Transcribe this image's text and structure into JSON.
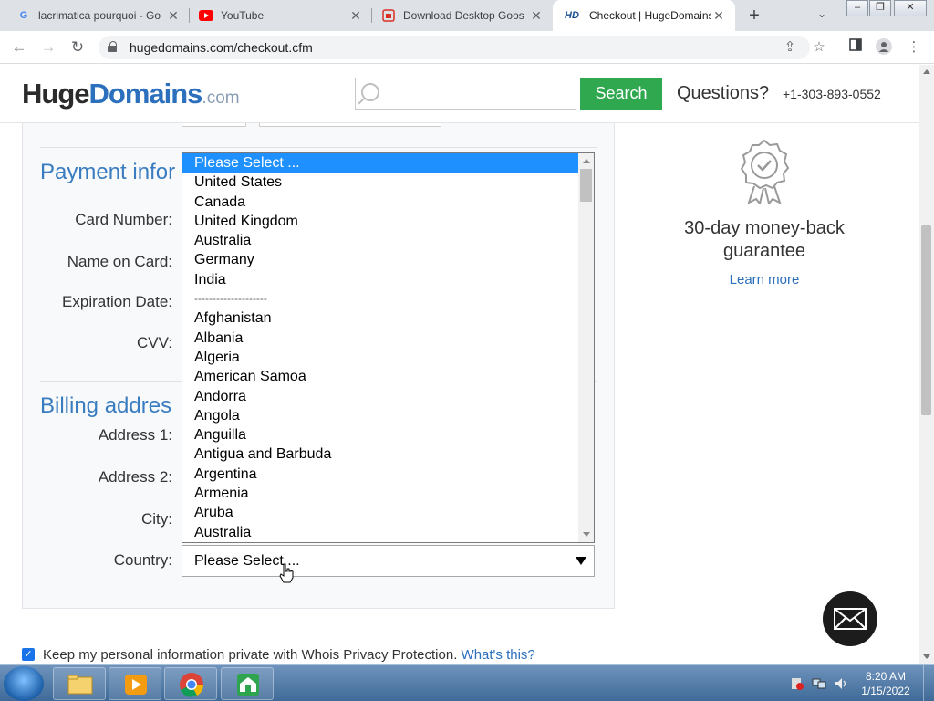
{
  "browser": {
    "tabs": [
      {
        "title": "lacrimatica pourquoi - Go",
        "favicon": "google-icon"
      },
      {
        "title": "YouTube",
        "favicon": "youtube-icon"
      },
      {
        "title": "Download Desktop Goos",
        "favicon": "download-site-icon"
      },
      {
        "title": "Checkout | HugeDomains",
        "favicon": "hugedomains-icon",
        "favicon_text": "HD",
        "active": true
      }
    ],
    "url": "hugedomains.com/checkout.cfm"
  },
  "header": {
    "logo_huge": "Huge",
    "logo_domains": "Domains",
    "logo_com": ".com",
    "search_placeholder": "",
    "search_button": "Search",
    "questions": "Questions?",
    "phone": "+1-303-893-0552"
  },
  "form": {
    "payment_title": "Payment infor",
    "billing_title": "Billing addres",
    "labels": {
      "card_number": "Card Number:",
      "name_on_card": "Name on Card:",
      "expiration": "Expiration Date:",
      "cvv": "CVV:",
      "address1": "Address 1:",
      "address2": "Address 2:",
      "city": "City:",
      "country": "Country:"
    },
    "country_selected": "Please Select ..."
  },
  "country_options": [
    "Please Select ...",
    "United States",
    "Canada",
    "United Kingdom",
    "Australia",
    "Germany",
    "India",
    "--------------------",
    "Afghanistan",
    "Albania",
    "Algeria",
    "American Samoa",
    "Andorra",
    "Angola",
    "Anguilla",
    "Antigua and Barbuda",
    "Argentina",
    "Armenia",
    "Aruba",
    "Australia"
  ],
  "guarantee": {
    "text": "30-day money-back guarantee",
    "link": "Learn more"
  },
  "privacy": {
    "text": "Keep my personal information private with Whois Privacy Protection.",
    "link": "What's this?",
    "checked": true
  },
  "taskbar": {
    "time": "8:20 AM",
    "date": "1/15/2022"
  },
  "colors": {
    "accent_blue": "#3a7cc0",
    "search_green": "#2fa84f",
    "selected_option": "#1e90ff"
  }
}
